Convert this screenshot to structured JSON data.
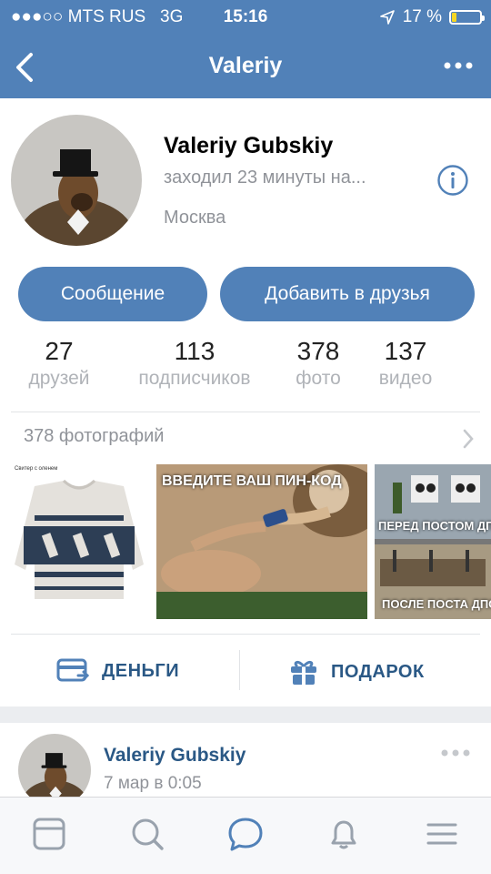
{
  "status": {
    "carrier": "●●●○○ MTS RUS",
    "network": "3G",
    "time": "15:16",
    "battery_pct": "17 %",
    "battery_level": 0.17
  },
  "nav": {
    "title": "Valeriy"
  },
  "profile": {
    "name": "Valeriy Gubskiy",
    "last_seen": "заходил 23 минуты на...",
    "city": "Москва",
    "message_btn": "Сообщение",
    "add_friend_btn": "Добавить в друзья"
  },
  "counters": [
    {
      "num": "27",
      "label": "друзей"
    },
    {
      "num": "113",
      "label": "подписчиков"
    },
    {
      "num": "378",
      "label": "фото"
    },
    {
      "num": "137",
      "label": "видео"
    }
  ],
  "photos": {
    "header": "378 фотографий",
    "sweater_caption": "Свитер с оленем",
    "meme_text": "ВВЕДИТЕ ВАШ ПИН-КОД",
    "before_text": "ПЕРЕД ПОСТОМ ДПС",
    "after_text": "ПОСЛЕ ПОСТА ДПС"
  },
  "actions": {
    "money": "ДЕНЬГИ",
    "gift": "ПОДАРОК"
  },
  "post": {
    "author": "Valeriy Gubskiy",
    "date": "7 мар в 0:05"
  },
  "colors": {
    "brand": "#5181b8",
    "link": "#2a5885",
    "secondary": "#909399"
  }
}
